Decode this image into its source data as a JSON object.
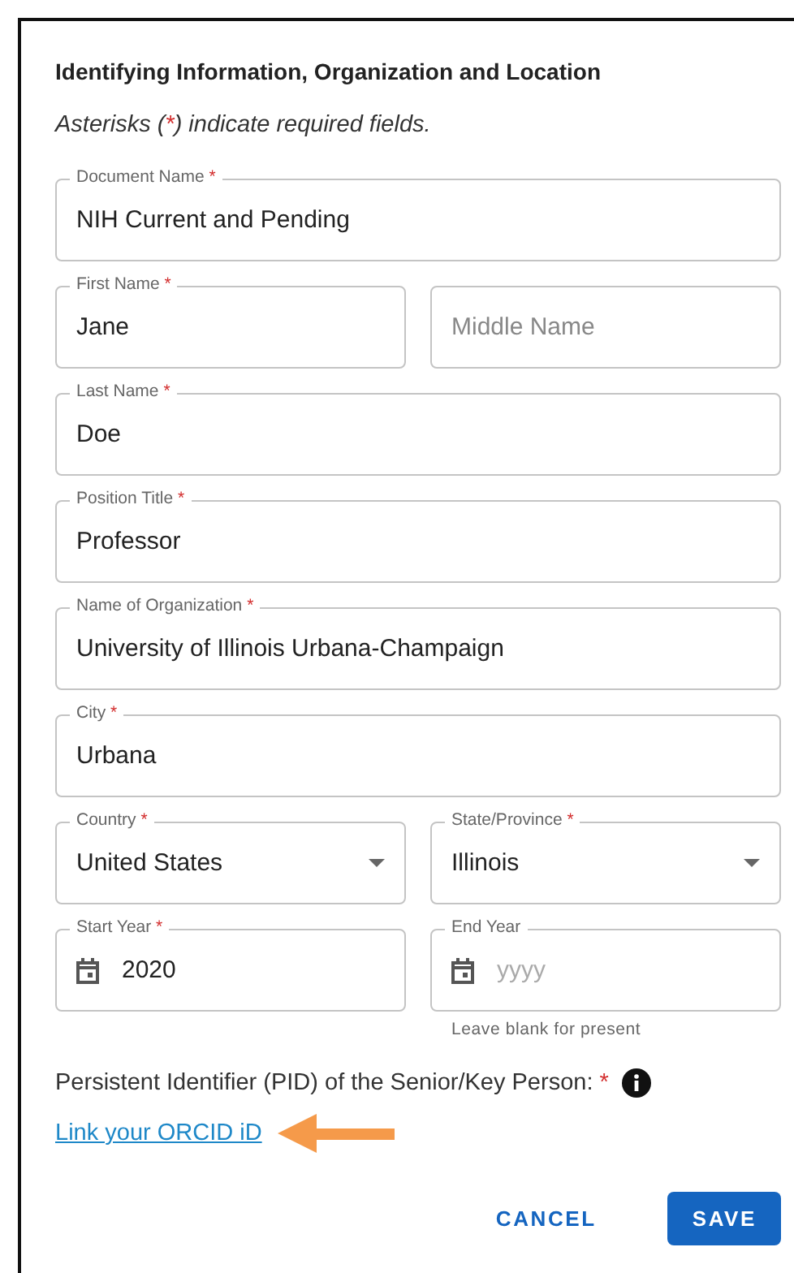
{
  "dialog": {
    "title": "Identifying Information, Organization and Location",
    "intro": {
      "before": "Asterisks (",
      "mark": "*",
      "after": ") indicate required fields."
    },
    "rows": [
      {
        "fields": [
          {
            "kind": "text",
            "label": "Document Name",
            "required_mark": "*",
            "value": "NIH Current and Pending"
          }
        ]
      },
      {
        "fields": [
          {
            "kind": "text",
            "label": "First Name",
            "required_mark": "*",
            "value": "Jane"
          },
          {
            "kind": "text",
            "placeholder": "Middle Name"
          }
        ]
      },
      {
        "fields": [
          {
            "kind": "text",
            "label": "Last Name",
            "required_mark": "*",
            "value": "Doe"
          }
        ]
      },
      {
        "fields": [
          {
            "kind": "text",
            "label": "Position Title",
            "required_mark": "*",
            "value": "Professor"
          }
        ]
      },
      {
        "fields": [
          {
            "kind": "text",
            "label": "Name of Organization",
            "required_mark": "*",
            "value": "University of Illinois Urbana-Champaign"
          }
        ]
      },
      {
        "fields": [
          {
            "kind": "text",
            "label": "City",
            "required_mark": "*",
            "value": "Urbana"
          }
        ]
      },
      {
        "fields": [
          {
            "kind": "select",
            "label": "Country",
            "required_mark": "*",
            "value": "United States"
          },
          {
            "kind": "select",
            "label": "State/Province",
            "required_mark": "*",
            "value": "Illinois"
          }
        ]
      },
      {
        "fields": [
          {
            "kind": "date",
            "label": "Start Year",
            "required_mark": "*",
            "value": "2020"
          },
          {
            "kind": "date",
            "label": "End Year",
            "placeholder": "yyyy",
            "helper": "Leave blank for present"
          }
        ]
      }
    ],
    "pid": {
      "label": "Persistent Identifier (PID) of the Senior/Key Person:",
      "required_mark": "*",
      "link": "Link your ORCID iD"
    },
    "buttons": [
      {
        "kind": "text",
        "label": "CANCEL"
      },
      {
        "kind": "contained",
        "label": "SAVE"
      }
    ]
  }
}
